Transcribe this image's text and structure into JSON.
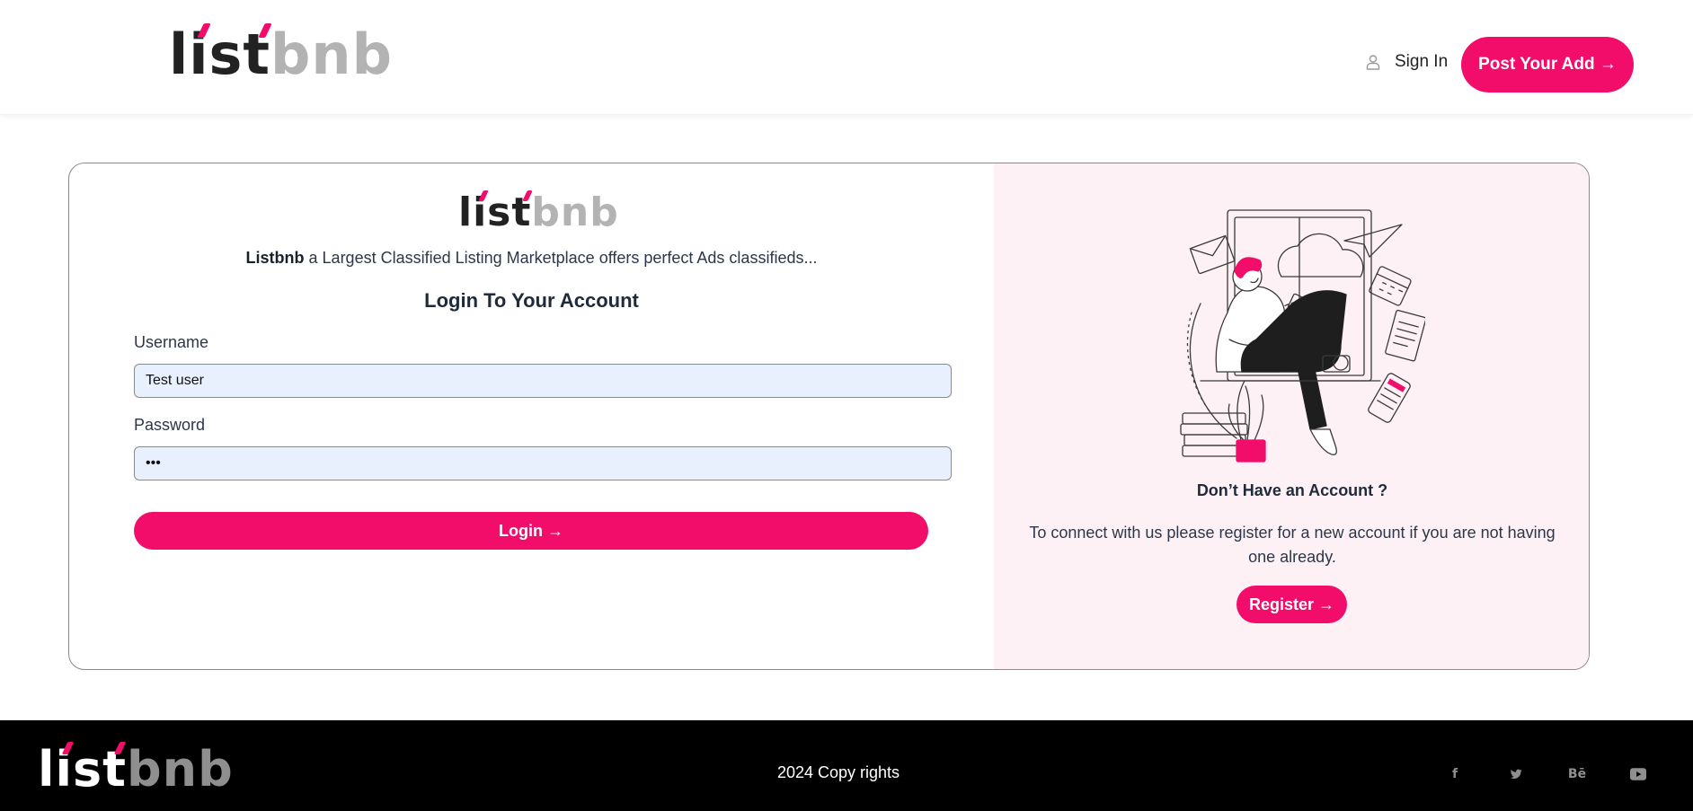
{
  "header": {
    "logo": {
      "part1": "list",
      "part2": "bnb"
    },
    "sign_in_label": "Sign In",
    "post_button_label": "Post Your Add →"
  },
  "login": {
    "logo": {
      "part1": "list",
      "part2": "bnb"
    },
    "tagline_brand": "Listbnb",
    "tagline_rest": " a Largest Classified Listing Marketplace offers perfect Ads classifieds...",
    "title": "Login To Your Account",
    "username_label": "Username",
    "username_value": "Test user",
    "password_label": "Password",
    "password_value": "•••",
    "login_button_label": "Login →"
  },
  "register": {
    "title": "Don’t Have an Account ?",
    "text": "To connect with us please register for a new account if you are not having one already.",
    "button_label": "Register →"
  },
  "footer": {
    "logo": {
      "part1": "list",
      "part2": "bnb"
    },
    "copyright": "2024 Copy rights",
    "socials": [
      {
        "icon": "facebook-icon",
        "glyph": "f"
      },
      {
        "icon": "twitter-icon",
        "glyph": "🐦"
      },
      {
        "icon": "behance-icon",
        "glyph": "Bē"
      },
      {
        "icon": "youtube-icon",
        "glyph": "▶"
      }
    ]
  },
  "colors": {
    "accent": "#f20d6b",
    "panel_bg": "#fdf1f5",
    "input_bg": "#e8f0fe"
  }
}
